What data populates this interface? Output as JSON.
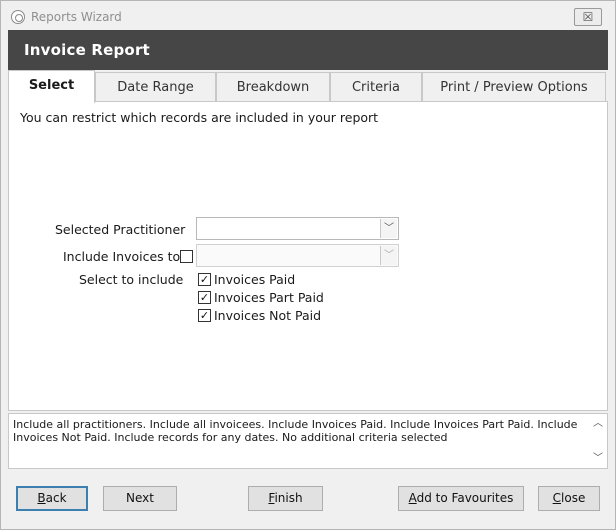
{
  "window": {
    "title": "Reports Wizard",
    "close_glyph": "☒"
  },
  "header": {
    "title": "Invoice Report"
  },
  "tabs": [
    {
      "label": "Select",
      "active": true
    },
    {
      "label": "Date Range",
      "active": false
    },
    {
      "label": "Breakdown",
      "active": false
    },
    {
      "label": "Criteria",
      "active": false
    },
    {
      "label": "Print / Preview Options",
      "active": false
    }
  ],
  "select_panel": {
    "intro": "You can restrict which records are included in your report",
    "practitioner": {
      "label": "Selected Practitioner",
      "value": ""
    },
    "include_invoices_to": {
      "label": "Include Invoices to",
      "checked": false,
      "value": ""
    },
    "select_to_include": {
      "label": "Select to include",
      "options": [
        {
          "label": "Invoices Paid",
          "checked": true
        },
        {
          "label": "Invoices Part Paid",
          "checked": true
        },
        {
          "label": "Invoices Not Paid",
          "checked": true
        }
      ]
    }
  },
  "summary": {
    "text": "Include all practitioners. Include all invoicees. Include Invoices Paid. Include Invoices Part Paid. Include Invoices Not Paid. Include records for any dates. No additional criteria selected"
  },
  "buttons": {
    "back": {
      "first": "B",
      "rest": "ack"
    },
    "next": {
      "label": "Next"
    },
    "finish": {
      "first": "F",
      "rest": "inish"
    },
    "add_to_favourites": {
      "first": "A",
      "rest": "dd to Favourites"
    },
    "close": {
      "first": "C",
      "rest": "lose"
    }
  },
  "glyphs": {
    "check": "✓",
    "combo_arrow": "﹀",
    "scroll_up": "︿",
    "scroll_down": "﹀"
  },
  "colors": {
    "header_bg": "#464646",
    "default_button_border": "#3c7fb1"
  }
}
